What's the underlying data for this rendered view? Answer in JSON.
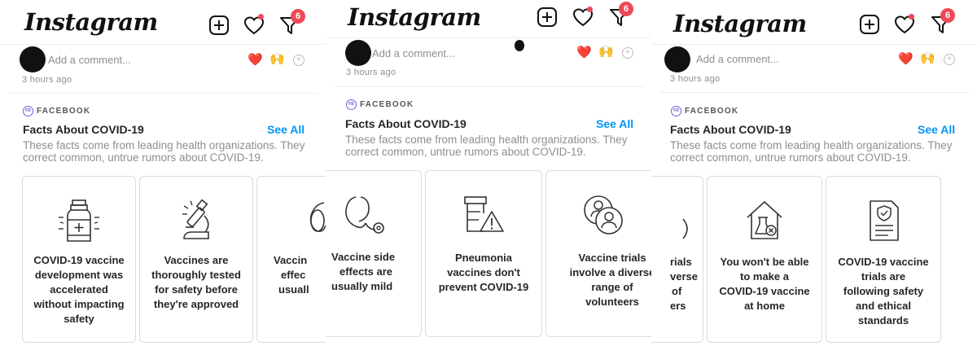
{
  "app": {
    "logo": "Instagram",
    "notification_count": "6"
  },
  "comment_bar": {
    "placeholder": "Add a comment...",
    "reactions": [
      "❤️",
      "🙌"
    ],
    "time": "3 hours ago"
  },
  "facts": {
    "source": "FACEBOOK",
    "title": "Facts About COVID-19",
    "see_all": "See All",
    "desc_line1": "These facts come from leading health organizations. They",
    "desc_line2": "correct common, untrue rumors about COVID-19."
  },
  "panels": [
    {
      "cards": [
        {
          "icon": "vaccine-vial-icon",
          "lines": [
            "COVID-19 vaccine",
            "development was",
            "accelerated",
            "without impacting",
            "safety"
          ]
        },
        {
          "icon": "microscope-icon",
          "lines": [
            "Vaccines are",
            "thoroughly tested",
            "for safety before",
            "they're approved"
          ]
        },
        {
          "icon": "stethoscope-icon",
          "lines": [
            "Vaccin",
            "effec",
            "usuall"
          ]
        }
      ]
    },
    {
      "cards": [
        {
          "icon": "stethoscope-icon",
          "lines": [
            "Vaccine side",
            "effects are",
            "usually mild"
          ]
        },
        {
          "icon": "pill-bottle-warning-icon",
          "lines": [
            "Pneumonia",
            "vaccines don't",
            "prevent COVID-19"
          ]
        },
        {
          "icon": "group-people-icon",
          "lines": [
            "Vaccine trials",
            "involve a diverse",
            "range of",
            "volunteers"
          ]
        }
      ]
    },
    {
      "cards": [
        {
          "icon": "group-people-icon",
          "lines": [
            "rials",
            "verse",
            "of",
            "ers"
          ]
        },
        {
          "icon": "home-lab-icon",
          "lines": [
            "You won't be able",
            "to make a",
            "COVID-19 vaccine",
            "at home"
          ]
        },
        {
          "icon": "document-shield-icon",
          "lines": [
            "COVID-19 vaccine",
            "trials are",
            "following safety",
            "and ethical",
            "standards"
          ]
        }
      ]
    }
  ]
}
